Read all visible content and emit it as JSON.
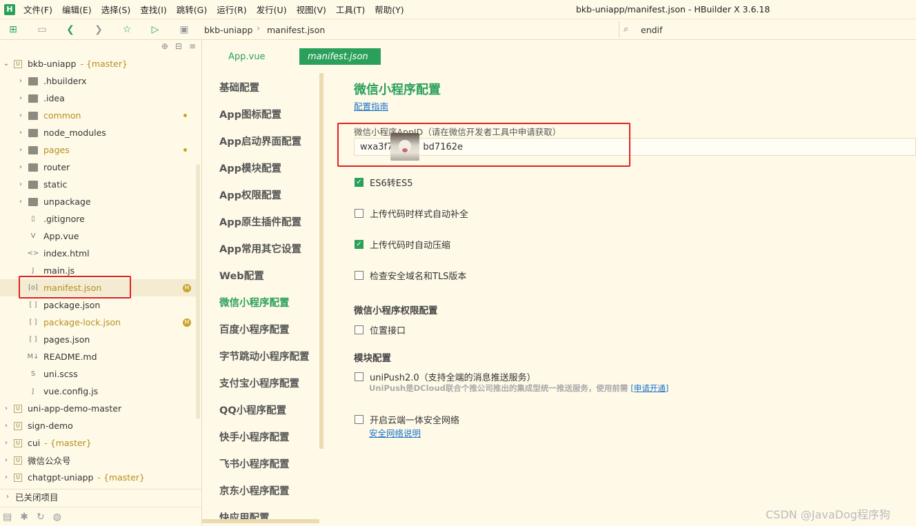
{
  "app": {
    "logo": "H",
    "window_title": "bkb-uniapp/manifest.json - HBuilder X 3.6.18"
  },
  "menu": [
    "文件(F)",
    "编辑(E)",
    "选择(S)",
    "查找(I)",
    "跳转(G)",
    "运行(R)",
    "发行(U)",
    "视图(V)",
    "工具(T)",
    "帮助(Y)"
  ],
  "toolbar": {
    "breadcrumb": [
      "bkb-uniapp",
      "manifest.json"
    ],
    "search_value": "endif"
  },
  "sidebar": {
    "tree": [
      {
        "name": "bkb-uniapp",
        "branch": "- {master}",
        "level": 0,
        "kind": "project",
        "expanded": true
      },
      {
        "name": ".hbuilderx",
        "level": 1,
        "kind": "folder"
      },
      {
        "name": ".idea",
        "level": 1,
        "kind": "folder"
      },
      {
        "name": "common",
        "level": 1,
        "kind": "folder",
        "modified": true
      },
      {
        "name": "node_modules",
        "level": 1,
        "kind": "folder"
      },
      {
        "name": "pages",
        "level": 1,
        "kind": "folder",
        "modified": true
      },
      {
        "name": "router",
        "level": 1,
        "kind": "folder"
      },
      {
        "name": "static",
        "level": 1,
        "kind": "folder"
      },
      {
        "name": "unpackage",
        "level": 1,
        "kind": "folder"
      },
      {
        "name": ".gitignore",
        "level": 1,
        "kind": "file"
      },
      {
        "name": "App.vue",
        "level": 1,
        "kind": "vue"
      },
      {
        "name": "index.html",
        "level": 1,
        "kind": "html"
      },
      {
        "name": "main.js",
        "level": 1,
        "kind": "js"
      },
      {
        "name": "manifest.json",
        "level": 1,
        "kind": "config",
        "selected": true,
        "badge": "M"
      },
      {
        "name": "package.json",
        "level": 1,
        "kind": "json"
      },
      {
        "name": "package-lock.json",
        "level": 1,
        "kind": "json",
        "badge": "M"
      },
      {
        "name": "pages.json",
        "level": 1,
        "kind": "json"
      },
      {
        "name": "README.md",
        "level": 1,
        "kind": "md"
      },
      {
        "name": "uni.scss",
        "level": 1,
        "kind": "scss"
      },
      {
        "name": "vue.config.js",
        "level": 1,
        "kind": "js"
      },
      {
        "name": "uni-app-demo-master",
        "level": 0,
        "kind": "project"
      },
      {
        "name": "sign-demo",
        "level": 0,
        "kind": "project"
      },
      {
        "name": "cui",
        "branch": "- {master}",
        "level": 0,
        "kind": "project"
      },
      {
        "name": "微信公众号",
        "level": 0,
        "kind": "project"
      },
      {
        "name": "chatgpt-uniapp",
        "branch": "- {master}",
        "level": 0,
        "kind": "project"
      }
    ],
    "closed_projects": "已关闭项目"
  },
  "tabs": [
    {
      "label": "App.vue",
      "active": false
    },
    {
      "label": "manifest.json",
      "active": true
    }
  ],
  "config_nav": [
    "基础配置",
    "App图标配置",
    "App启动界面配置",
    "App模块配置",
    "App权限配置",
    "App原生插件配置",
    "App常用其它设置",
    "Web配置",
    "微信小程序配置",
    "百度小程序配置",
    "字节跳动小程序配置",
    "支付宝小程序配置",
    "QQ小程序配置",
    "快手小程序配置",
    "飞书小程序配置",
    "京东小程序配置",
    "快应用配置"
  ],
  "config_nav_active": 8,
  "main": {
    "title": "微信小程序配置",
    "guide_link": "配置指南",
    "appid_label": "微信小程序AppID（请在微信开发者工具中申请获取）",
    "appid_value_left": "wxa3f7",
    "appid_value_right": "bd7162e",
    "options": [
      {
        "label": "ES6转ES5",
        "checked": true
      },
      {
        "label": "上传代码时样式自动补全",
        "checked": false
      },
      {
        "label": "上传代码时自动压缩",
        "checked": true
      },
      {
        "label": "检查安全域名和TLS版本",
        "checked": false
      }
    ],
    "perm_title": "微信小程序权限配置",
    "perm_option": {
      "label": "位置接口",
      "checked": false
    },
    "module_title": "模块配置",
    "unipush": {
      "label": "uniPush2.0（支持全端的消息推送服务）",
      "checked": false,
      "desc": "UniPush是DCloud联合个推公司推出的集成型统一推送服务，使用前需",
      "link": "[申请开通]"
    },
    "secure": {
      "label": "开启云端一体安全网络",
      "checked": false,
      "link": "安全网络说明"
    }
  },
  "watermark": "CSDN @JavaDog程序狗"
}
